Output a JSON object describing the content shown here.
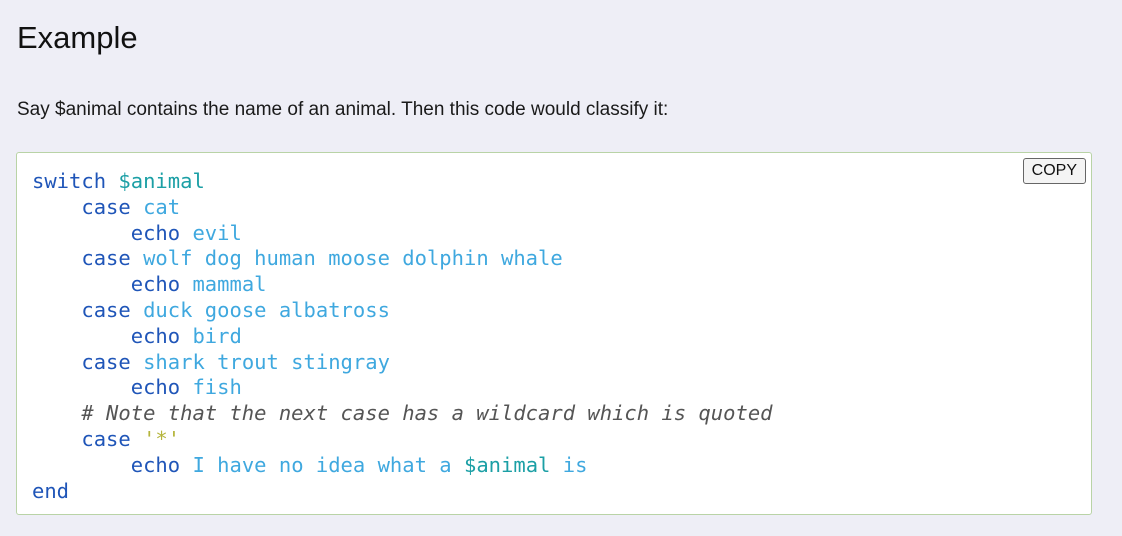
{
  "section": {
    "title": "Example",
    "intro": "Say $animal contains the name of an animal. Then this code would classify it:"
  },
  "code_block": {
    "copy_label": "COPY",
    "lines": {
      "l1": {
        "kw": "switch",
        "var": "$animal"
      },
      "l2": {
        "kw": "case",
        "args": "cat"
      },
      "l3": {
        "kw": "echo",
        "args": "evil"
      },
      "l4": {
        "kw": "case",
        "args": "wolf dog human moose dolphin whale"
      },
      "l5": {
        "kw": "echo",
        "args": "mammal"
      },
      "l6": {
        "kw": "case",
        "args": "duck goose albatross"
      },
      "l7": {
        "kw": "echo",
        "args": "bird"
      },
      "l8": {
        "kw": "case",
        "args": "shark trout stingray"
      },
      "l9": {
        "kw": "echo",
        "args": "fish"
      },
      "l10": {
        "comment": "# Note that the next case has a wildcard which is quoted"
      },
      "l11": {
        "kw": "case",
        "str": "'*'"
      },
      "l12": {
        "kw": "echo",
        "args": "I have no idea what a",
        "var": "$animal",
        "args2": "is"
      },
      "l13": {
        "kw": "end"
      }
    }
  },
  "colors": {
    "keyword": "#1f55b8",
    "argument": "#3fa8df",
    "variable": "#1b9fa5",
    "string": "#b5b53c",
    "comment": "#555555",
    "code_border": "#b9d3a6",
    "page_background": "#eeeef6"
  }
}
